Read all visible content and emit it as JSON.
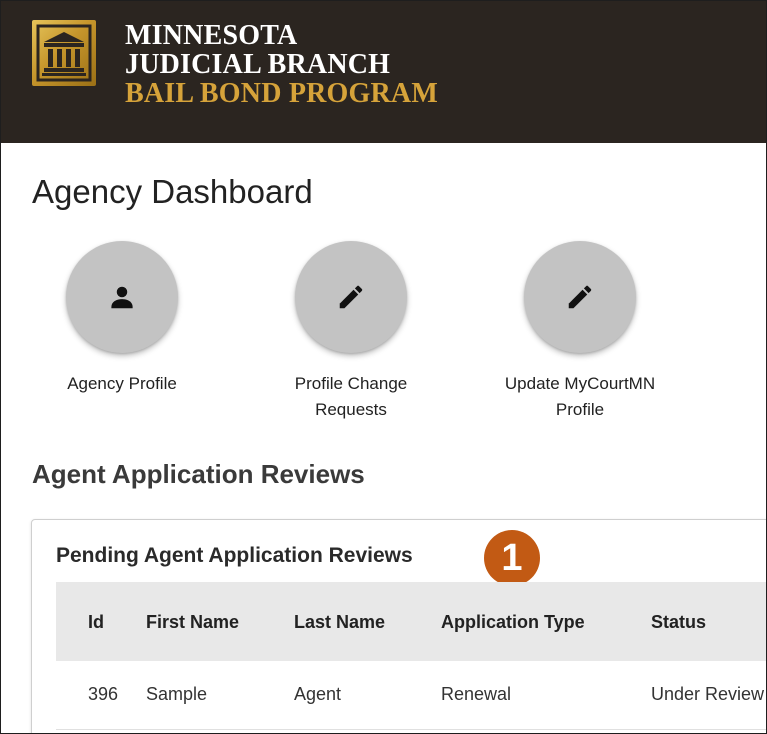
{
  "header": {
    "line1": "MINNESOTA",
    "line2": "JUDICIAL BRANCH",
    "line3": "BAIL BOND PROGRAM",
    "logo_icon": "courthouse-icon",
    "accent": "#d6a33a",
    "background": "#2b2520"
  },
  "page": {
    "title": "Agency Dashboard"
  },
  "actions": [
    {
      "label": "Agency Profile",
      "icon": "person-icon"
    },
    {
      "label": "Profile Change Requests",
      "icon": "pencil-icon"
    },
    {
      "label": "Update MyCourtMN Profile",
      "icon": "pencil-icon"
    }
  ],
  "reviews": {
    "section_title": "Agent Application Reviews",
    "card_title": "Pending Agent Application Reviews",
    "callout": "1",
    "callout_color": "#c25a14",
    "columns": [
      "Id",
      "First Name",
      "Last Name",
      "Application Type",
      "Status"
    ],
    "rows": [
      {
        "id": "396",
        "first_name": "Sample",
        "last_name": "Agent",
        "application_type": "Renewal",
        "status": "Under Review"
      }
    ]
  }
}
